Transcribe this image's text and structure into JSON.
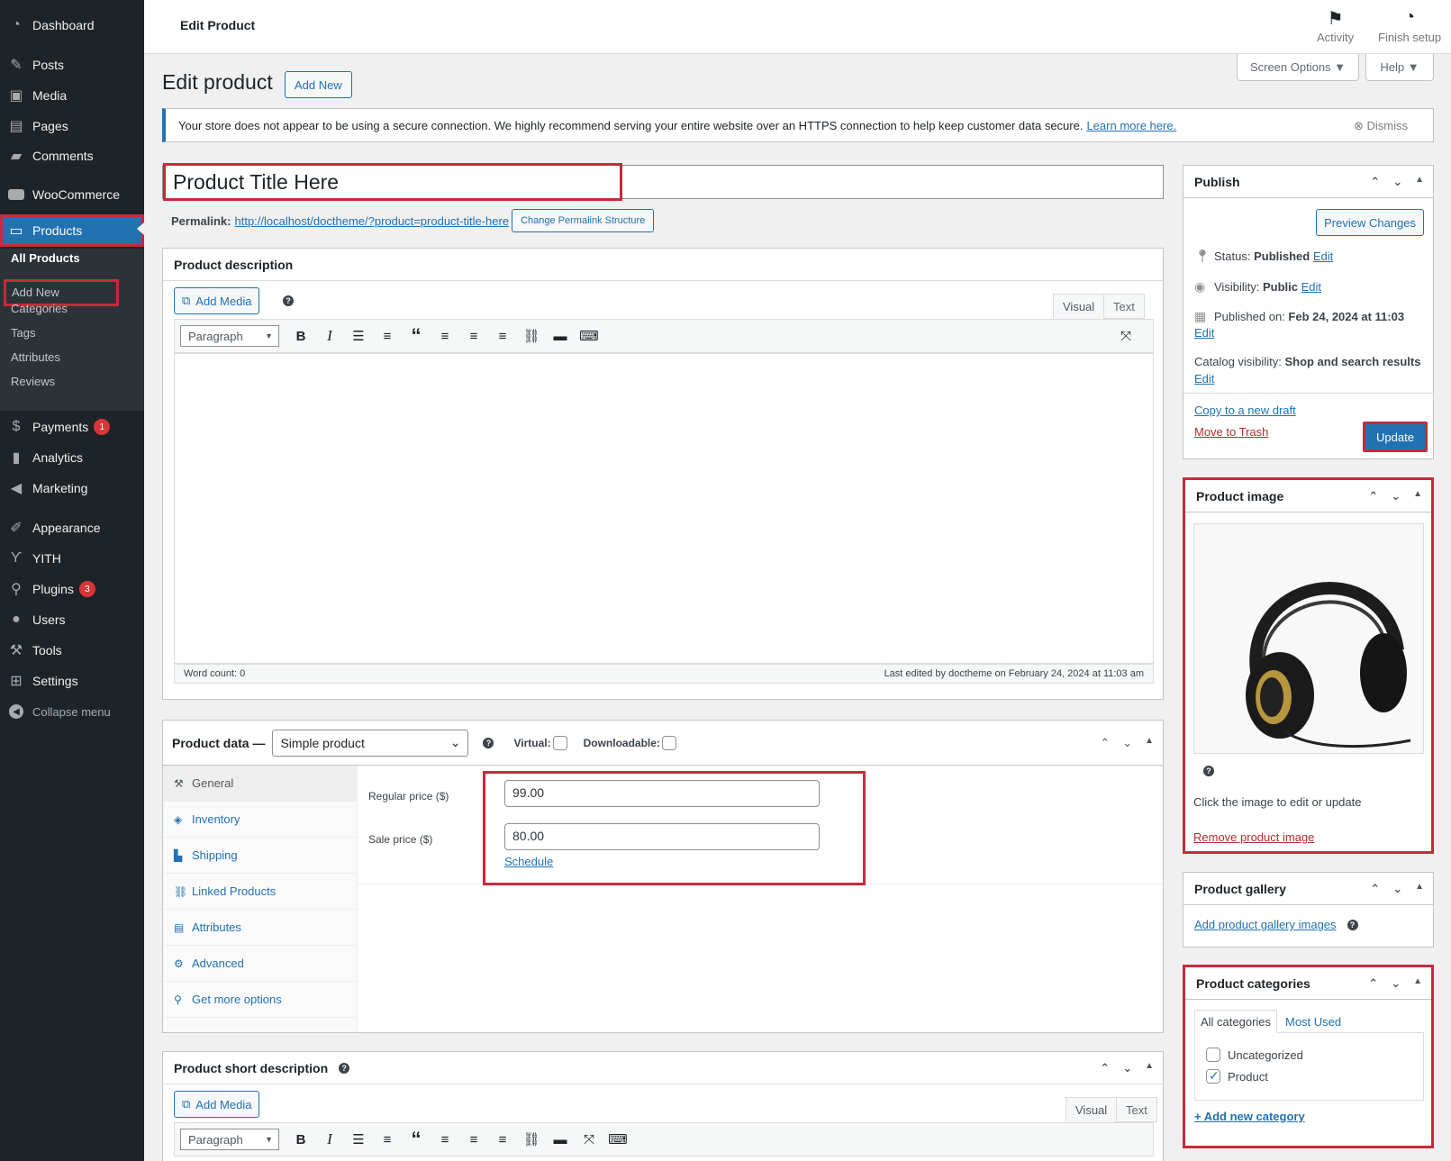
{
  "sidebar": {
    "items": [
      {
        "label": "Dashboard",
        "icon": "dashboard-icon"
      },
      {
        "label": "Posts",
        "icon": "pin-icon"
      },
      {
        "label": "Media",
        "icon": "media-icon"
      },
      {
        "label": "Pages",
        "icon": "pages-icon"
      },
      {
        "label": "Comments",
        "icon": "comments-icon"
      },
      {
        "label": "WooCommerce",
        "icon": "woocommerce-icon"
      },
      {
        "label": "Products",
        "icon": "archive-icon"
      },
      {
        "label": "Payments",
        "icon": "payments-icon",
        "badge": "1"
      },
      {
        "label": "Analytics",
        "icon": "analytics-icon"
      },
      {
        "label": "Marketing",
        "icon": "megaphone-icon"
      },
      {
        "label": "Appearance",
        "icon": "paintbrush-icon"
      },
      {
        "label": "YITH",
        "icon": "yith-icon"
      },
      {
        "label": "Plugins",
        "icon": "plugins-icon",
        "badge": "3"
      },
      {
        "label": "Users",
        "icon": "users-icon"
      },
      {
        "label": "Tools",
        "icon": "wrench-icon"
      },
      {
        "label": "Settings",
        "icon": "settings-icon"
      },
      {
        "label": "Collapse menu",
        "icon": "collapse-icon"
      }
    ],
    "submenu": [
      "All Products",
      "Add New",
      "Categories",
      "Tags",
      "Attributes",
      "Reviews"
    ]
  },
  "topbar": {
    "title": "Edit Product",
    "activity": "Activity",
    "finish_setup": "Finish setup"
  },
  "screen_options": "Screen Options ▼",
  "help": "Help ▼",
  "heading": "Edit product",
  "add_new": "Add New",
  "notice": {
    "text": "Your store does not appear to be using a secure connection. We highly recommend serving your entire website over an HTTPS connection to help keep customer data secure.",
    "link": "Learn more here.",
    "dismiss": "Dismiss"
  },
  "title_value": "Product Title Here",
  "permalink": {
    "label": "Permalink:",
    "url": "http://localhost/doctheme/?product=product-title-here",
    "button": "Change Permalink Structure"
  },
  "description": {
    "title": "Product description",
    "add_media": "Add Media",
    "tab_visual": "Visual",
    "tab_text": "Text",
    "format": "Paragraph",
    "word_count": "Word count: 0",
    "last_edited": "Last edited by doctheme on February 24, 2024 at 11:03 am"
  },
  "product_data": {
    "title": "Product data —",
    "type": "Simple product",
    "virtual": "Virtual:",
    "downloadable": "Downloadable:",
    "tabs": [
      "General",
      "Inventory",
      "Shipping",
      "Linked Products",
      "Attributes",
      "Advanced",
      "Get more options"
    ],
    "regular_price_label": "Regular price ($)",
    "regular_price": "99.00",
    "sale_price_label": "Sale price ($)",
    "sale_price": "80.00",
    "schedule": "Schedule"
  },
  "short_description": {
    "title": "Product short description",
    "add_media": "Add Media",
    "tab_visual": "Visual",
    "tab_text": "Text",
    "format": "Paragraph"
  },
  "publish": {
    "title": "Publish",
    "preview": "Preview Changes",
    "status_label": "Status:",
    "status_value": "Published",
    "visibility_label": "Visibility:",
    "visibility_value": "Public",
    "published_label": "Published on:",
    "published_value": "Feb 24, 2024 at 11:03",
    "catalog_label": "Catalog visibility:",
    "catalog_value": "Shop and search results",
    "edit": "Edit",
    "copy_draft": "Copy to a new draft",
    "trash": "Move to Trash",
    "update": "Update"
  },
  "product_image": {
    "title": "Product image",
    "hint": "Click the image to edit or update",
    "remove": "Remove product image"
  },
  "gallery": {
    "title": "Product gallery",
    "add": "Add product gallery images"
  },
  "categories": {
    "title": "Product categories",
    "tab_all": "All categories",
    "tab_used": "Most Used",
    "items": [
      {
        "label": "Uncategorized",
        "checked": false
      },
      {
        "label": "Product",
        "checked": true
      }
    ],
    "add_new": "+ Add new category"
  },
  "colors": {
    "accent": "#2271b1",
    "highlight": "#c72a3a",
    "sidebar": "#1d2327",
    "danger": "#b32d2e"
  }
}
